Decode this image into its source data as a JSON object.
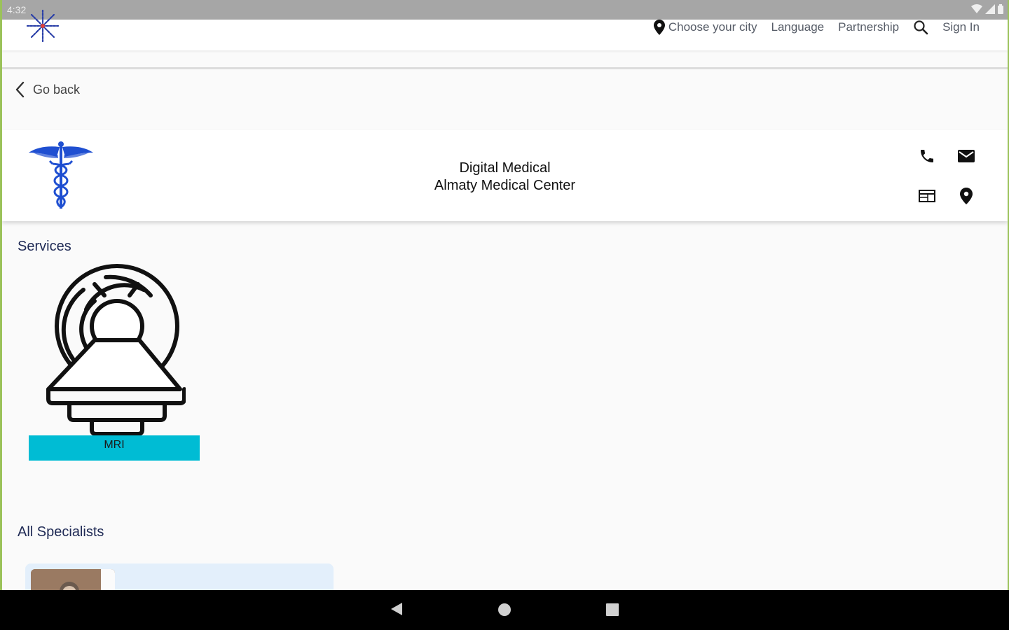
{
  "status_bar": {
    "time": "4:32"
  },
  "header": {
    "nav": {
      "city": "Choose your city",
      "language": "Language",
      "partnership": "Partnership",
      "sign_in": "Sign In"
    }
  },
  "go_back": "Go back",
  "clinic": {
    "line1": "Digital Medical",
    "line2": "Almaty Medical Center"
  },
  "services": {
    "title": "Services",
    "items": [
      {
        "label": "MRI"
      }
    ]
  },
  "specialists": {
    "title": "All Specialists"
  },
  "colors": {
    "accent": "#00bcd4",
    "title_text": "#1f2a55",
    "caduceus": "#1f4fd1"
  }
}
